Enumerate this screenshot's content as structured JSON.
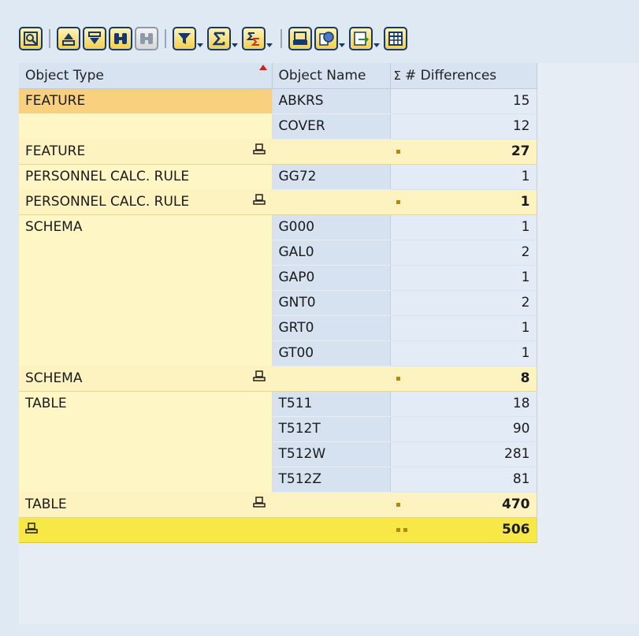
{
  "toolbar": {
    "buttons": [
      {
        "name": "details-icon"
      },
      {
        "name": "sort-ascending-icon"
      },
      {
        "name": "sort-descending-icon"
      },
      {
        "name": "find-icon"
      },
      {
        "name": "find-next-icon",
        "disabled": true
      },
      {
        "name": "set-filter-icon",
        "dropdown": true
      },
      {
        "name": "total-icon",
        "dropdown": true
      },
      {
        "name": "subtotals-icon",
        "dropdown": true
      },
      {
        "name": "print-preview-icon"
      },
      {
        "name": "views-icon",
        "dropdown": true
      },
      {
        "name": "export-icon",
        "dropdown": true
      },
      {
        "name": "layout-icon"
      }
    ]
  },
  "table": {
    "columns": {
      "object_type": "Object Type",
      "object_name": "Object Name",
      "differences_sigma": "Σ",
      "differences": "# Differences"
    },
    "rows": [
      {
        "kind": "item",
        "type": "FEATURE",
        "name": "ABKRS",
        "diff": "15",
        "selected": true
      },
      {
        "kind": "item",
        "type": "",
        "name": "COVER",
        "diff": "12"
      },
      {
        "kind": "subtotal",
        "type": "FEATURE",
        "diff": "27"
      },
      {
        "kind": "item",
        "type": "PERSONNEL CALC. RULE",
        "name": "GG72",
        "diff": "1"
      },
      {
        "kind": "subtotal",
        "type": "PERSONNEL CALC. RULE",
        "diff": "1"
      },
      {
        "kind": "item",
        "type": "SCHEMA",
        "name": "G000",
        "diff": "1"
      },
      {
        "kind": "item",
        "type": "",
        "name": "GAL0",
        "diff": "2"
      },
      {
        "kind": "item",
        "type": "",
        "name": "GAP0",
        "diff": "1"
      },
      {
        "kind": "item",
        "type": "",
        "name": "GNT0",
        "diff": "2"
      },
      {
        "kind": "item",
        "type": "",
        "name": "GRT0",
        "diff": "1"
      },
      {
        "kind": "item",
        "type": "",
        "name": "GT00",
        "diff": "1"
      },
      {
        "kind": "subtotal",
        "type": "SCHEMA",
        "diff": "8"
      },
      {
        "kind": "item",
        "type": "TABLE",
        "name": "T511",
        "diff": "18"
      },
      {
        "kind": "item",
        "type": "",
        "name": "T512T",
        "diff": "90"
      },
      {
        "kind": "item",
        "type": "",
        "name": "T512W",
        "diff": "281"
      },
      {
        "kind": "item",
        "type": "",
        "name": "T512Z",
        "diff": "81"
      },
      {
        "kind": "subtotal",
        "type": "TABLE",
        "diff": "470"
      },
      {
        "kind": "total",
        "type": "",
        "diff": "506"
      }
    ]
  }
}
